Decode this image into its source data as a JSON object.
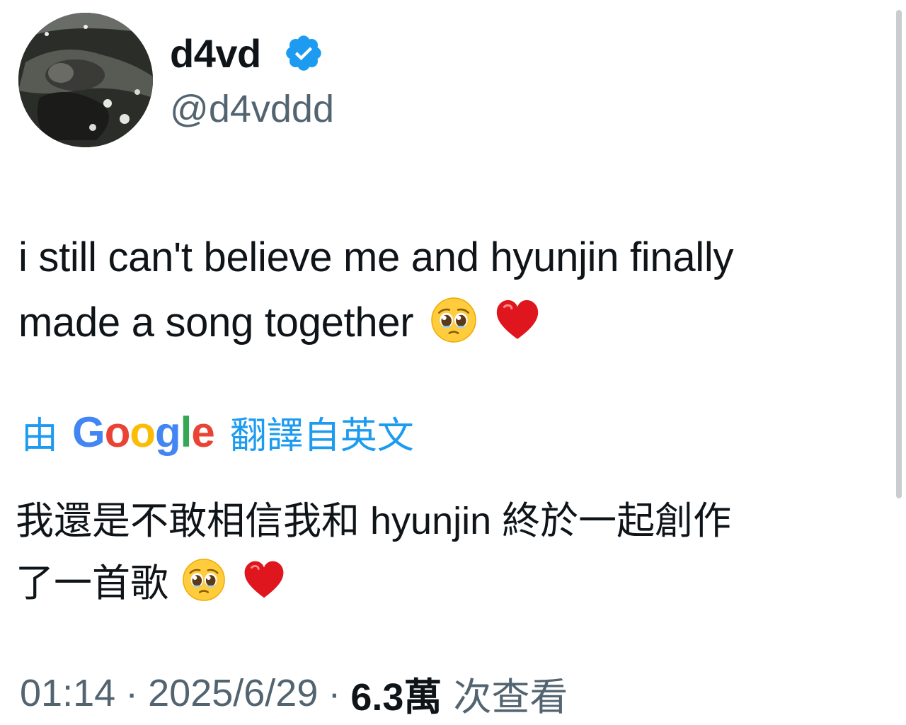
{
  "author": {
    "display_name": "d4vd",
    "handle": "@d4vddd",
    "verified": true,
    "avatar_icon": "profile-photo"
  },
  "tweet": {
    "line1": "i still can't believe me and hyunjin finally",
    "line2": "made a song together",
    "emojis": [
      "pleading-face",
      "red-heart"
    ]
  },
  "translation": {
    "prefix": "由",
    "provider_logo": [
      "G",
      "o",
      "o",
      "g",
      "l",
      "e"
    ],
    "suffix": "翻譯自英文",
    "line1": "我還是不敢相信我和 hyunjin 終於一起創作",
    "line2": "了一首歌",
    "link_color": "#1d9bf0"
  },
  "meta": {
    "time": "01:14",
    "separator": "·",
    "date": "2025/6/29",
    "views_count": "6.3萬",
    "views_label": "次查看"
  },
  "colors": {
    "text": "#0f1419",
    "secondary": "#536471",
    "accent": "#1d9bf0"
  }
}
